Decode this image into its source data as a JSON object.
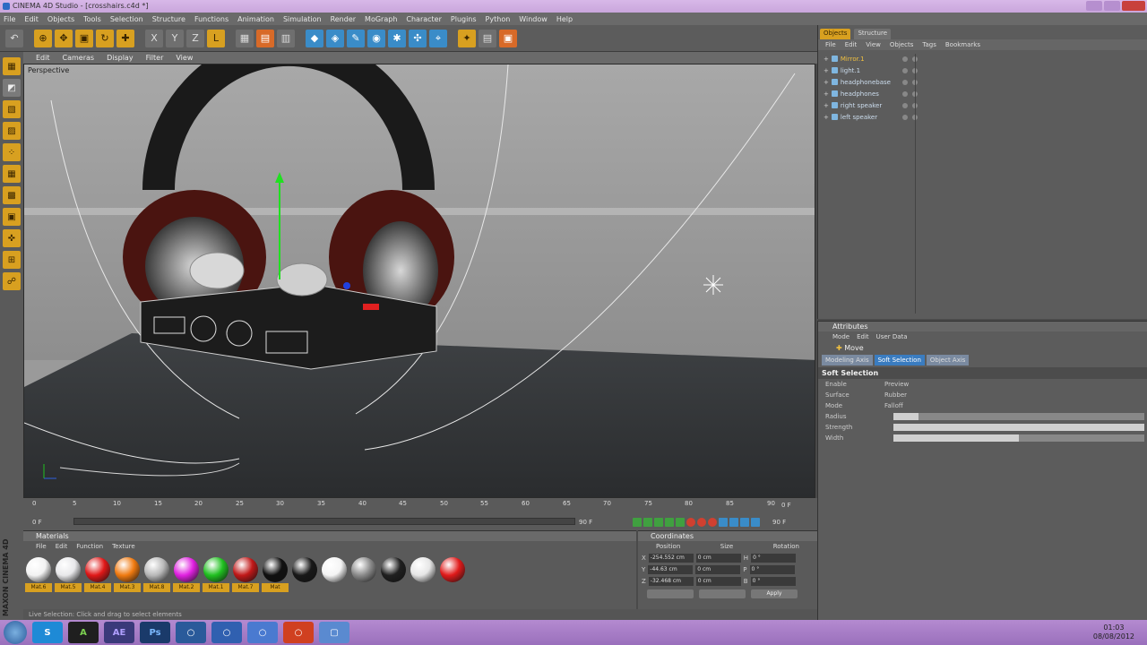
{
  "window": {
    "title": "CINEMA 4D Studio - [crosshairs.c4d *]"
  },
  "menubar": [
    "File",
    "Edit",
    "Objects",
    "Tools",
    "Selection",
    "Structure",
    "Functions",
    "Animation",
    "Simulation",
    "Render",
    "MoGraph",
    "Character",
    "Plugins",
    "Python",
    "Window",
    "Help"
  ],
  "viewport": {
    "menu": [
      "Edit",
      "Cameras",
      "Display",
      "Filter",
      "View"
    ],
    "label": "Perspective"
  },
  "timeline": {
    "ticks": [
      "0",
      "5",
      "10",
      "15",
      "20",
      "25",
      "30",
      "35",
      "40",
      "45",
      "50",
      "55",
      "60",
      "65",
      "70",
      "75",
      "80",
      "85",
      "90"
    ],
    "current_frame": "0 F",
    "start_frame": "0 F",
    "end_frame": "90 F",
    "end_frame_right": "90 F"
  },
  "materials": {
    "title": "Materials",
    "menu": [
      "File",
      "Edit",
      "Function",
      "Texture"
    ],
    "items": [
      {
        "name": "Mat.6",
        "color": "#f2f2f2"
      },
      {
        "name": "Mat.5",
        "color": "#e8e8ea"
      },
      {
        "name": "Mat.4",
        "color": "#e01818"
      },
      {
        "name": "Mat.3",
        "color": "#f07a10"
      },
      {
        "name": "Mat.8",
        "color": "#b8b8b8"
      },
      {
        "name": "Mat.2",
        "color": "#e020e0"
      },
      {
        "name": "Mat.1",
        "color": "#20c020"
      },
      {
        "name": "Mat.7",
        "color": "#c01818"
      },
      {
        "name": "Mat",
        "color": "#101010"
      },
      {
        "name": "",
        "color": "#181818"
      },
      {
        "name": "",
        "color": "#f4f4f4"
      },
      {
        "name": "",
        "color": "#8a8a8a"
      },
      {
        "name": "",
        "color": "#202020"
      },
      {
        "name": "",
        "color": "#e6e6e6"
      },
      {
        "name": "",
        "color": "#e01a1a"
      }
    ]
  },
  "coordinates": {
    "title": "Coordinates",
    "headers": [
      "Position",
      "Size",
      "Rotation"
    ],
    "rows": [
      {
        "axis": "X",
        "position": "-254.552 cm",
        "size": "0 cm",
        "rot_label": "H",
        "rotation": "0 °"
      },
      {
        "axis": "Y",
        "position": "-44.63 cm",
        "size": "0 cm",
        "rot_label": "P",
        "rotation": "0 °"
      },
      {
        "axis": "Z",
        "position": "-32.468 cm",
        "size": "0 cm",
        "rot_label": "B",
        "rotation": "0 °"
      }
    ],
    "apply": "Apply"
  },
  "status": {
    "text": "Live Selection: Click and drag to select elements"
  },
  "maxon": {
    "logo_text": "MAXON CINEMA 4D"
  },
  "objects": {
    "tabs": [
      "Objects",
      "Structure"
    ],
    "menu": [
      "File",
      "Edit",
      "View",
      "Objects",
      "Tags",
      "Bookmarks"
    ],
    "items": [
      {
        "name": "Mirror.1",
        "selected": true
      },
      {
        "name": "light.1",
        "selected": false
      },
      {
        "name": "headphonebase",
        "selected": false
      },
      {
        "name": "headphones",
        "selected": false
      },
      {
        "name": "right speaker",
        "selected": false
      },
      {
        "name": "left speaker",
        "selected": false
      }
    ]
  },
  "attributes": {
    "title": "Attributes",
    "menu": [
      "Mode",
      "Edit",
      "User Data"
    ],
    "mode": "Move",
    "tabs": [
      "Modeling Axis",
      "Soft Selection",
      "Object Axis"
    ],
    "section": "Soft Selection",
    "rows": [
      {
        "label": "Enable",
        "label2": "Preview"
      },
      {
        "label": "Surface",
        "label2": "Rubber"
      },
      {
        "label": "Mode",
        "label2": "Falloff"
      },
      {
        "label": "Radius",
        "label2": ""
      },
      {
        "label": "Strength",
        "label2": ""
      },
      {
        "label": "Width",
        "label2": ""
      }
    ],
    "sliders": [
      {
        "label": "Radius",
        "fill": 0.1
      },
      {
        "label": "Strength",
        "fill": 1.0
      },
      {
        "label": "Width",
        "fill": 0.5
      }
    ]
  },
  "taskbar": {
    "apps": [
      "S",
      "A",
      "AE",
      "Ps",
      "○",
      "○",
      "○",
      "○",
      "▢"
    ],
    "time": "01:03",
    "date": "08/08/2012"
  }
}
